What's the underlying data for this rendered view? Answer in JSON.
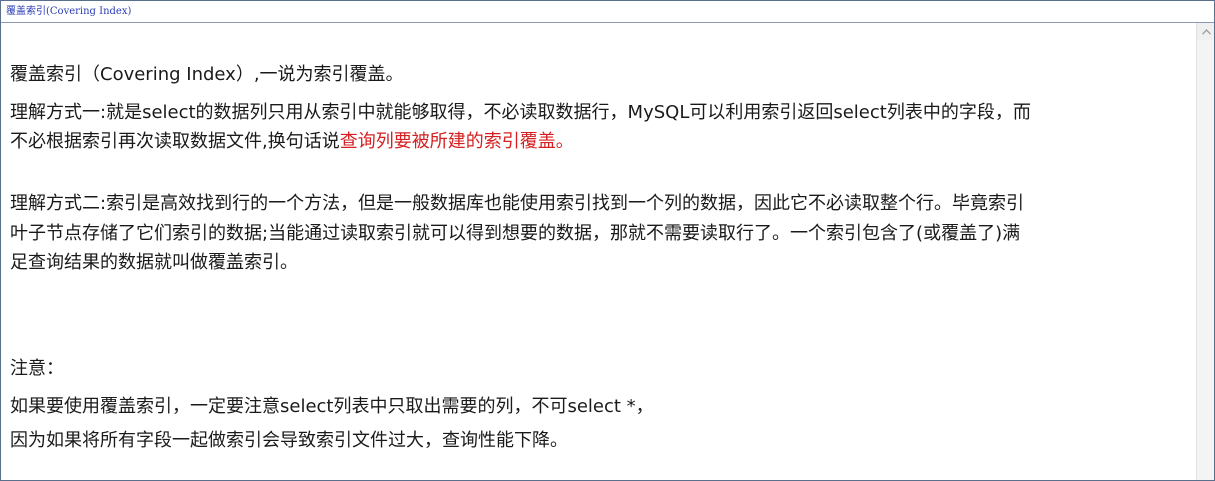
{
  "window": {
    "title": "覆盖索引(Covering Index)"
  },
  "content": {
    "heading": "覆盖索引（Covering Index）,一说为索引覆盖。",
    "way1_line1": "理解方式一:就是select的数据列只用从索引中就能够取得，不必读取数据行，MySQL可以利用索引返回select列表中的字段，而",
    "way1_line2_prefix": "不必根据索引再次读取数据文件,换句话说",
    "way1_line2_highlight": "查询列要被所建的索引覆盖。",
    "way2_line1": "理解方式二:索引是高效找到行的一个方法，但是一般数据库也能使用索引找到一个列的数据，因此它不必读取整个行。毕竟索引",
    "way2_line2": "叶子节点存储了它们索引的数据;当能通过读取索引就可以得到想要的数据，那就不需要读取行了。一个索引包含了(或覆盖了)满",
    "way2_line3": "足查询结果的数据就叫做覆盖索引。",
    "note_label": "注意：",
    "note_line1": "如果要使用覆盖索引，一定要注意select列表中只取出需要的列，不可select *，",
    "note_line2": "因为如果将所有字段一起做索引会导致索引文件过大，查询性能下降。",
    "highlight_color": "#d42020"
  }
}
